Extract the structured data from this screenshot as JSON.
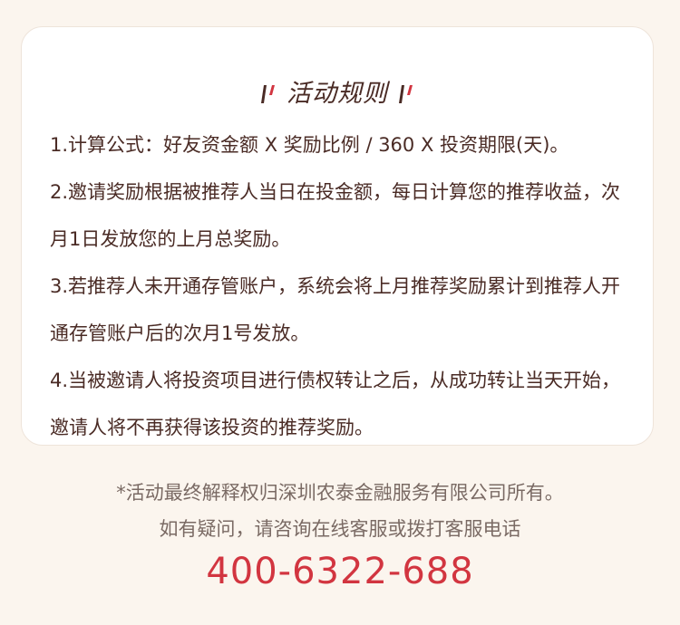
{
  "card": {
    "title": "活动规则",
    "rules": [
      "1.计算公式：好友资金额 X 奖励比例 / 360 X 投资期限(天)。",
      "2.邀请奖励根据被推荐人当日在投金额，每日计算您的推荐收益，次月1日发放您的上月总奖励。",
      "3.若推荐人未开通存管账户，系统会将上月推荐奖励累计到推荐人开通存管账户后的次月1号发放。",
      "4.当被邀请人将投资项目进行债权转让之后，从成功转让当天开始，邀请人将不再获得该投资的推荐奖励。"
    ]
  },
  "footer": {
    "disclaimer": "*活动最终解释权归深圳农泰金融服务有限公司所有。",
    "contact_text": "如有疑问，请咨询在线客服或拨打客服电话",
    "hotline": "400-6322-688"
  },
  "colors": {
    "page_background": "#fbf5ee",
    "card_background": "#ffffff",
    "text_primary": "#4a2b25",
    "text_muted": "#7a6a64",
    "accent_red": "#d23540"
  },
  "icons": {
    "title_left": "slash-marks-icon",
    "title_right": "slash-marks-icon"
  }
}
